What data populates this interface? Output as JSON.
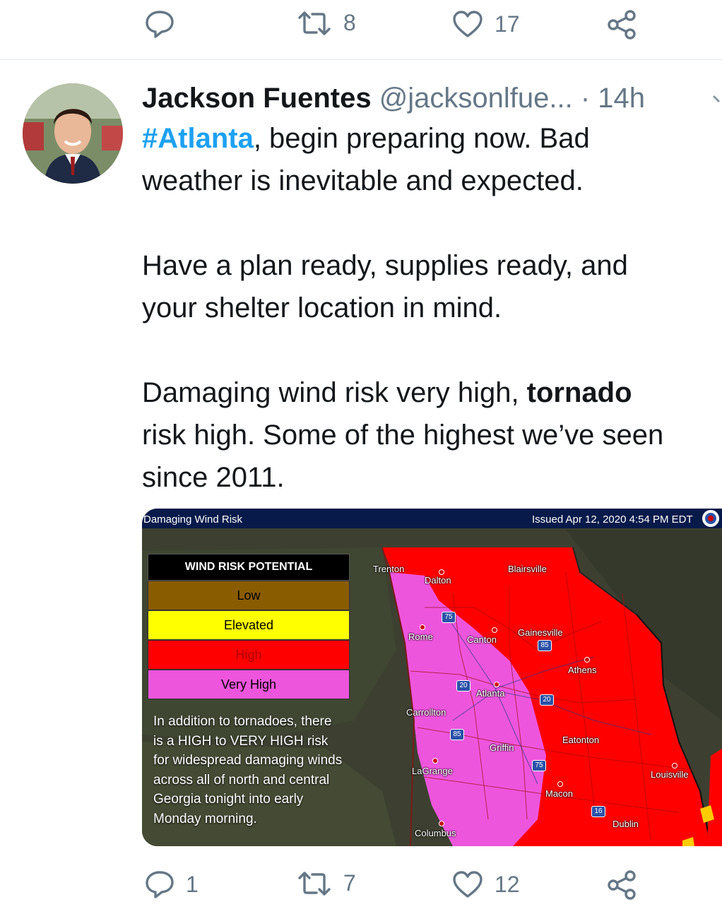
{
  "top_actions": {
    "reply_count": "",
    "retweet_count": "8",
    "like_count": "17"
  },
  "tweet": {
    "author_name": "Jackson Fuentes",
    "handle_time": " @jacksonlfue... · 14h",
    "hashtag": "#Atlanta",
    "line1_rest": ", begin preparing now. Bad",
    "line2": "weather is inevitable and expected.",
    "line3": "Have a plan ready, supplies ready, and",
    "line4": "your shelter location in mind.",
    "line5_start": "Damaging wind risk very high, ",
    "line5_bold": "tornado",
    "line6": "risk high. Some of the highest we’ve seen",
    "line7": "since 2011."
  },
  "map": {
    "title_left": "Damaging Wind Risk",
    "title_right": "Issued Apr 12, 2020 4:54 PM EDT",
    "legend_title": "WIND RISK POTENTIAL",
    "legend": [
      {
        "label": "Low",
        "color": "#8a5c00"
      },
      {
        "label": "Elevated",
        "color": "#ffff00"
      },
      {
        "label": "High",
        "color": "#ff0000"
      },
      {
        "label": "Very High",
        "color": "#ee55dd"
      }
    ],
    "note_lines": [
      "In addition to tornadoes, there",
      "is a HIGH to VERY HIGH risk",
      "for widespread damaging winds",
      "across all of north and central",
      "Georgia tonight into early",
      "Monday morning."
    ],
    "cities": [
      "Trenton",
      "Dalton",
      "Blairsville",
      "Rome",
      "Canton",
      "Gainesville",
      "Athens",
      "Atlanta",
      "Carrollton",
      "Griffin",
      "Eatonton",
      "LaGrange",
      "Louisville",
      "Macon",
      "Dublin",
      "Columbus"
    ],
    "highways": [
      "75",
      "85",
      "20",
      "20",
      "85",
      "75",
      "16"
    ]
  },
  "bottom_actions": {
    "reply_count": "1",
    "retweet_count": "7",
    "like_count": "12"
  }
}
